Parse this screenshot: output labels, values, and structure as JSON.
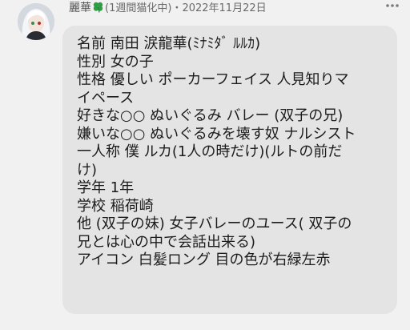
{
  "post": {
    "author_name": "麗華",
    "status_text": "(1週間猫化中)",
    "separator": "・",
    "date": "2022年11月22日",
    "badge_icon": "four-leaf-clover-icon",
    "more_icon": "more-dots-icon"
  },
  "message": {
    "lines": [
      "名前 南田 涙龍華(ﾐﾅﾐﾀﾞ ﾙﾙｶ)",
      "性別 女の子",
      "性格 優しい ポーカーフェイス 人見知りマ",
      "イペース",
      "好きな○○ ぬいぐるみ バレー (双子の兄)",
      "嫌いな○○ ぬいぐるみを壊す奴 ナルシスト",
      "一人称 僕 ルカ(1人の時だけ)(ルトの前だ",
      "け)",
      "学年 1年",
      "学校 稲荷崎",
      "他 (双子の妹) 女子バレーのユース( 双子の",
      "兄とは心の中で会話出来る)",
      "アイコン 白髪ロング 目の色が右緑左赤"
    ]
  },
  "colors": {
    "background": "#f1f1f1",
    "bubble": "#e4e4e4",
    "text": "#1c1c1c",
    "meta_text": "#6a6a6a",
    "clover": "#2ea043"
  }
}
